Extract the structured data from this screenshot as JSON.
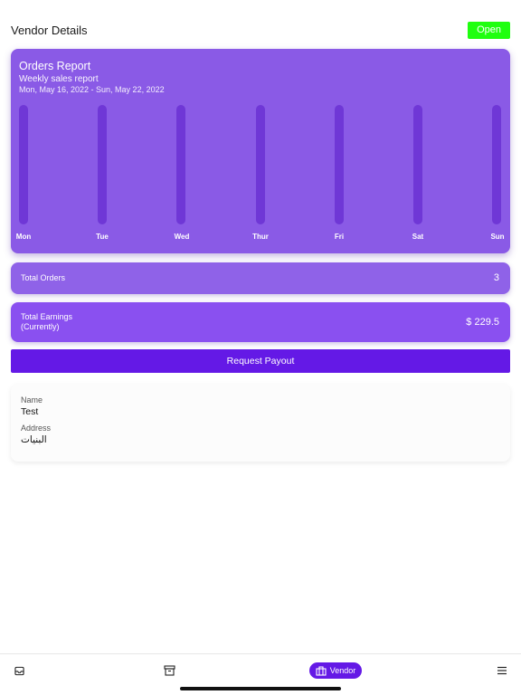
{
  "header": {
    "title": "Vendor Details",
    "status": "Open",
    "status_color": "#1fff0f"
  },
  "report": {
    "title": "Orders Report",
    "subtitle": "Weekly sales report",
    "date_range": "Mon, May 16, 2022  -  Sun, May 22, 2022",
    "card_color": "#8a5ae6",
    "bar_track_color": "#6f37d6",
    "days": [
      {
        "label": "Mon",
        "fill": 0
      },
      {
        "label": "Tue",
        "fill": 0
      },
      {
        "label": "Wed",
        "fill": 0
      },
      {
        "label": "Thur",
        "fill": 0
      },
      {
        "label": "Fri",
        "fill": 0
      },
      {
        "label": "Sat",
        "fill": 0
      },
      {
        "label": "Sun",
        "fill": 0
      }
    ]
  },
  "stats": {
    "orders_label": "Total Orders",
    "orders_value": "3",
    "earnings_label_line1": "Total Earnings",
    "earnings_label_line2": "(Currently)",
    "earnings_value": "$ 229.5"
  },
  "payout": {
    "button_label": "Request Payout",
    "button_color": "#6419e6"
  },
  "vendor": {
    "name_label": "Name",
    "name_value": "Test",
    "address_label": "Address",
    "address_value": "البنيات"
  },
  "bottom_nav": {
    "items": [
      {
        "icon": "inbox-icon"
      },
      {
        "icon": "archive-icon"
      },
      {
        "icon": "store-icon",
        "label": "Vendor",
        "active": true
      },
      {
        "icon": "menu-icon"
      }
    ]
  }
}
